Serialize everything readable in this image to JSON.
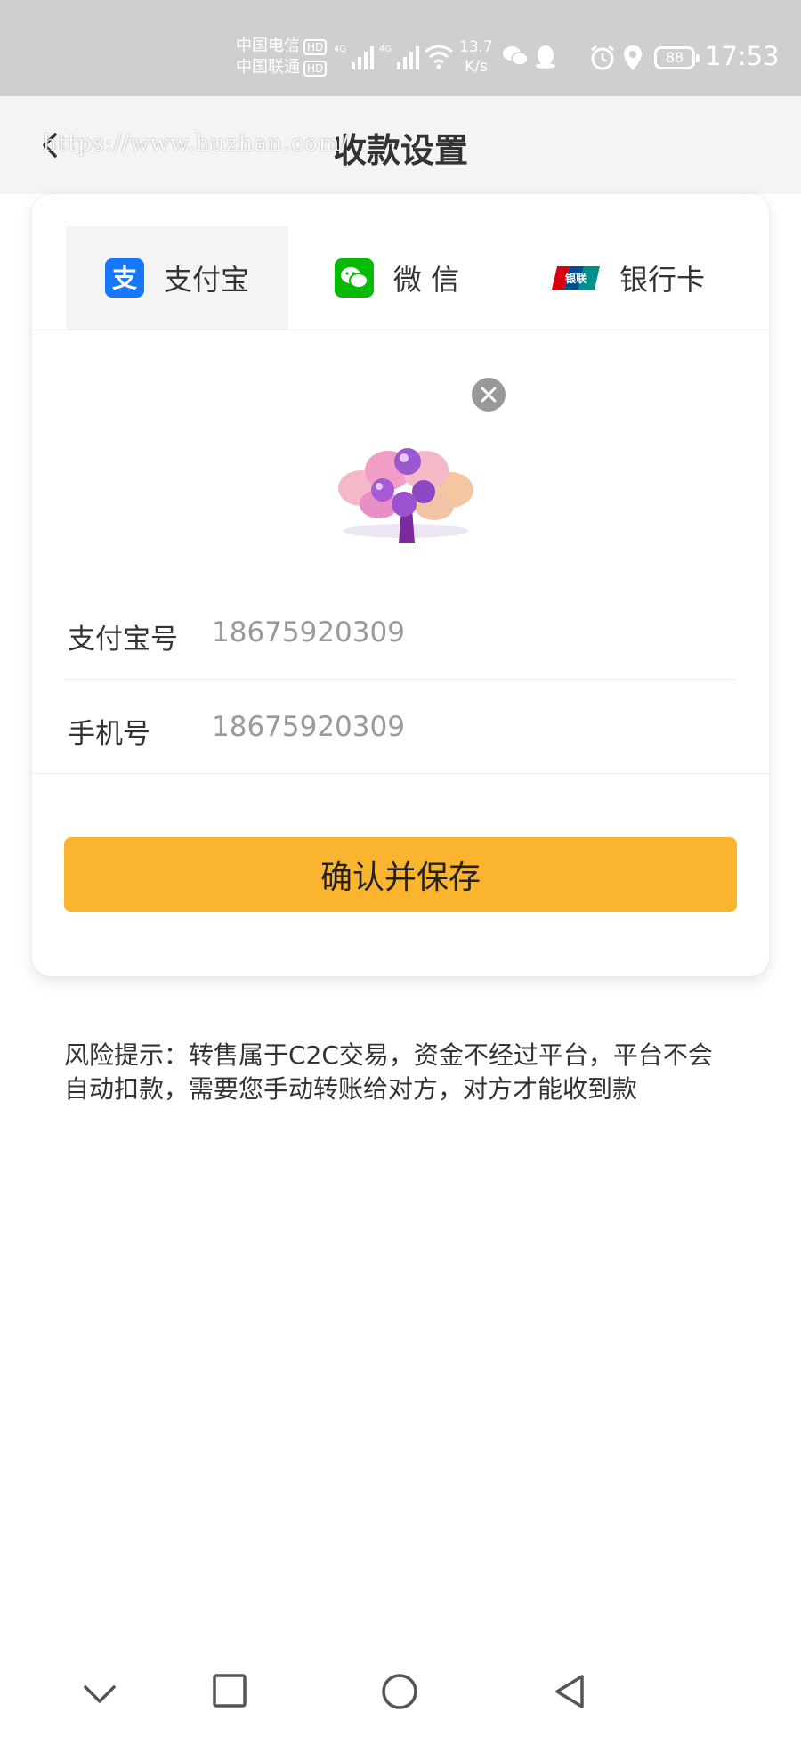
{
  "status_bar": {
    "carrier1": "中国电信",
    "carrier2": "中国联通",
    "hd": "HD",
    "net_speed_value": "13.7",
    "net_speed_unit": "K/s",
    "battery": "88",
    "time": "17:53"
  },
  "header": {
    "title": "收款设置",
    "watermark": "https://www.huzhan.com/"
  },
  "tabs": [
    {
      "label": "支付宝",
      "icon": "alipay-icon",
      "active": true
    },
    {
      "label": "微 信",
      "icon": "wechat-icon",
      "active": false
    },
    {
      "label": "银行卡",
      "icon": "unionpay-icon",
      "active": false
    }
  ],
  "form": {
    "alipay_label": "支付宝号",
    "alipay_value": "18675920309",
    "phone_label": "手机号",
    "phone_value": "18675920309",
    "qr_image": "money-tree-image",
    "remove_icon": "close-icon"
  },
  "save_button": "确认并保存",
  "risk_notice": {
    "line1": "风险提示：转售属于C2C交易，资金不经过平台，平台不会",
    "line2": "自动扣款，需要您手动转账给对方，对方才能收到款"
  },
  "colors": {
    "accent": "#fbb42d",
    "alipay_blue": "#1677ff",
    "wechat_green": "#09bb07",
    "unionpay_red": "#d7000f"
  },
  "nav_icons": [
    "chevron-down-icon",
    "square-icon",
    "circle-icon",
    "triangle-back-icon"
  ]
}
